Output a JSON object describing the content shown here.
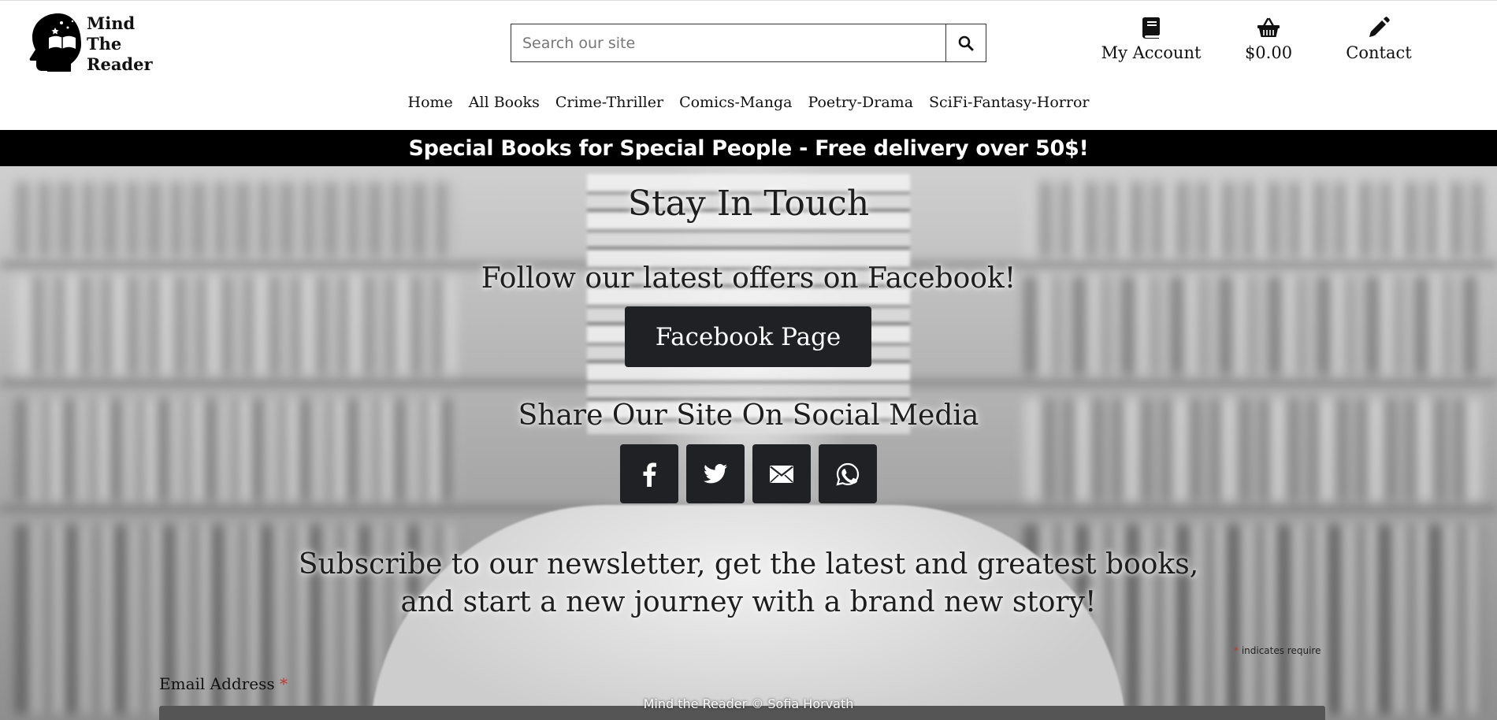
{
  "header": {
    "logo": {
      "line1": "Mind",
      "line2": "The",
      "line3": "Reader",
      "icon": "head-with-book-icon"
    },
    "search": {
      "placeholder": "Search our site",
      "value": "",
      "button_icon": "search-icon"
    },
    "nav_icons": [
      {
        "label": "My Account",
        "icon": "book-icon"
      },
      {
        "label": "$0.00",
        "icon": "basket-icon"
      },
      {
        "label": "Contact",
        "icon": "pencil-icon"
      }
    ],
    "menu": [
      {
        "label": "Home"
      },
      {
        "label": "All Books"
      },
      {
        "label": "Crime-Thriller"
      },
      {
        "label": "Comics-Manga"
      },
      {
        "label": "Poetry-Drama"
      },
      {
        "label": "SciFi-Fantasy-Horror"
      }
    ]
  },
  "banner": {
    "text": "Special Books for Special People - Free delivery over 50$!"
  },
  "hero": {
    "title": "Stay In Touch",
    "follow_text": "Follow our latest offers on Facebook!",
    "facebook_button": "Facebook Page",
    "share_title": "Share Our Site On Social Media",
    "share_buttons": [
      {
        "icon": "facebook-icon"
      },
      {
        "icon": "twitter-icon"
      },
      {
        "icon": "email-icon"
      },
      {
        "icon": "whatsapp-icon"
      }
    ],
    "subscribe_line1": "Subscribe to our newsletter, get the latest and greatest books,",
    "subscribe_line2": "and start a new journey with a brand new story!"
  },
  "newsletter": {
    "required_asterisk": "*",
    "required_note": " indicates require",
    "email_label": "Email Address ",
    "email_value": ""
  },
  "footer": {
    "text": "Mind the Reader © Sofia Horvath"
  },
  "colors": {
    "banner_bg": "#000000",
    "button_bg": "#1f2125",
    "required": "#c0392b"
  }
}
